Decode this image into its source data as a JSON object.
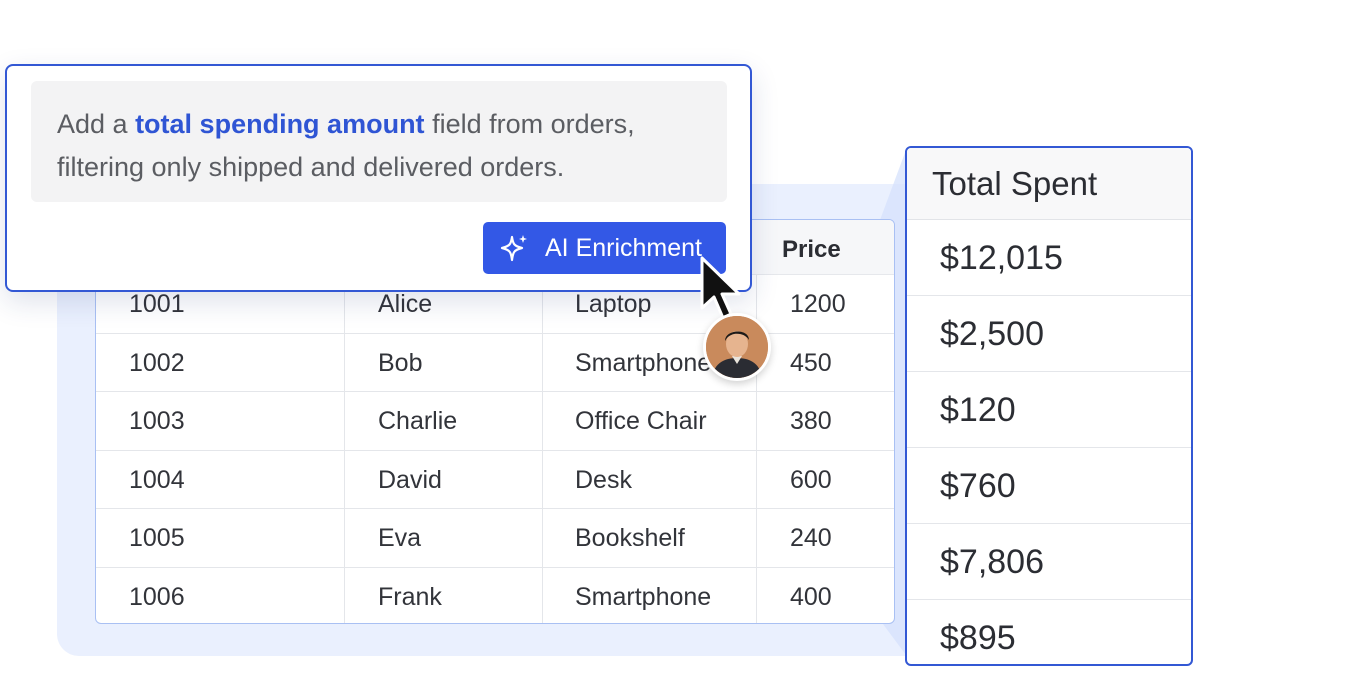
{
  "prompt": {
    "text_before": "Add a ",
    "highlight": "total spending amount",
    "text_after": " field from orders, filtering only shipped and delivered orders."
  },
  "ai_button": {
    "label": "AI Enrichment",
    "icon": "sparkle-icon"
  },
  "table": {
    "visible_header": "Price",
    "rows": [
      [
        "1001",
        "Alice",
        "Laptop",
        "1200"
      ],
      [
        "1002",
        "Bob",
        "Smartphone",
        "450"
      ],
      [
        "1003",
        "Charlie",
        "Office Chair",
        "380"
      ],
      [
        "1004",
        "David",
        "Desk",
        "600"
      ],
      [
        "1005",
        "Eva",
        "Bookshelf",
        "240"
      ],
      [
        "1006",
        "Frank",
        "Smartphone",
        "400"
      ]
    ]
  },
  "total_spent": {
    "header": "Total Spent",
    "values": [
      "$12,015",
      "$2,500",
      "$120",
      "$760",
      "$7,806",
      "$895"
    ]
  },
  "colors": {
    "accent": "#3358e6",
    "accent_border": "#3358d4",
    "highlight_text": "#2f55d4",
    "backdrop": "#eaf0fe"
  }
}
